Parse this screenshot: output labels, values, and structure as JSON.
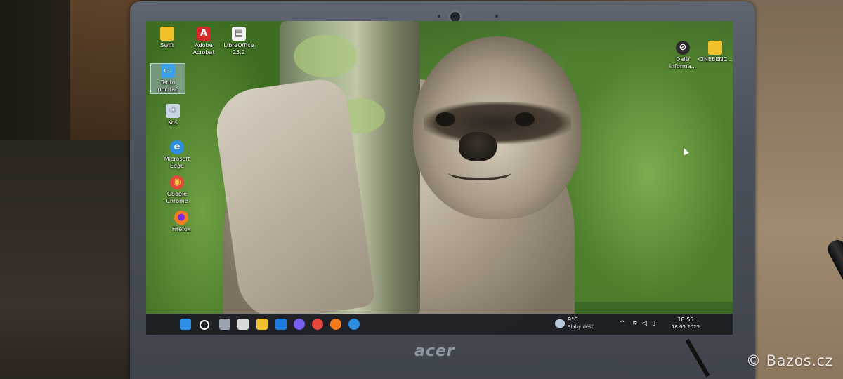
{
  "desktop_icons": [
    {
      "name": "swift",
      "label": "Swift",
      "glyph": "▬",
      "color": "#f2c02b"
    },
    {
      "name": "adobe-acrobat",
      "label": "Adobe Acrobat",
      "glyph": "A",
      "color": "#d22a2a"
    },
    {
      "name": "libreoffice",
      "label": "LibreOffice 25.2",
      "glyph": "▤",
      "color": "#f4f4f4"
    },
    {
      "name": "this-pc",
      "label": "Tento počítač",
      "glyph": "▭",
      "color": "#3aa0e8"
    },
    {
      "name": "recycle-bin",
      "label": "Koš",
      "glyph": "♲",
      "color": "#c9d6e3"
    },
    {
      "name": "microsoft-edge",
      "label": "Microsoft Edge",
      "glyph": "e",
      "color": "#2d8ee0"
    },
    {
      "name": "google-chrome",
      "label": "Google Chrome",
      "glyph": "◉",
      "color": "#e5463a"
    },
    {
      "name": "firefox",
      "label": "Firefox",
      "glyph": "●",
      "color": "#f57b1f"
    },
    {
      "name": "more-info",
      "label": "Další informa...",
      "glyph": "⊘",
      "color": "#2b2b2b"
    },
    {
      "name": "cinebench",
      "label": "CINEBENC...",
      "glyph": "▬",
      "color": "#f2c02b"
    }
  ],
  "taskbar": {
    "weather_temp": "9°C",
    "weather_desc": "Slabý déšť",
    "time": "18:55",
    "date": "18.05.2025",
    "colors": {
      "start": "#2f8fe6",
      "search": "#ffffff",
      "taskview": "#9aa3ae",
      "store": "#d9d9d9",
      "explorer": "#f2c02b",
      "outlook": "#1f7ae0",
      "copilot": "#7b5cf0",
      "chrome": "#e5463a",
      "firefox": "#f57b1f",
      "edge": "#2d8ee0"
    }
  },
  "laptop": {
    "brand": "acer"
  },
  "watermark": "© Bazos.cz"
}
